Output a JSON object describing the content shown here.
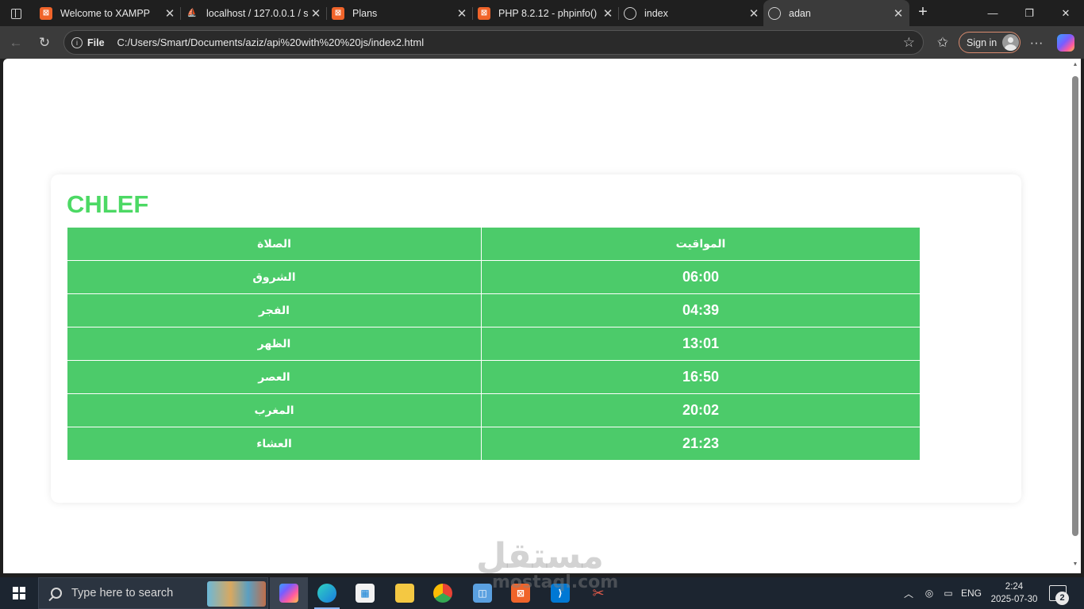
{
  "browser": {
    "tabs": [
      {
        "title": "Welcome to XAMPP",
        "favicon": "xampp-icon"
      },
      {
        "title": "localhost / 127.0.0.1 / s",
        "favicon": "phpmyadmin-icon"
      },
      {
        "title": "Plans",
        "favicon": "xampp-icon"
      },
      {
        "title": "PHP 8.2.12 - phpinfo()",
        "favicon": "xampp-icon"
      },
      {
        "title": "index",
        "favicon": "globe-icon"
      },
      {
        "title": "adan",
        "favicon": "globe-icon",
        "active": true
      }
    ],
    "address_bar": {
      "protocol_label": "File",
      "url": "C:/Users/Smart/Documents/aziz/api%20with%20%20js/index2.html"
    },
    "sign_in_label": "Sign in"
  },
  "page": {
    "city": "CHLEF",
    "table": {
      "headers": [
        "الصلاة",
        "المواقيت"
      ],
      "rows": [
        {
          "prayer": "الشروق",
          "time": "06:00"
        },
        {
          "prayer": "الفجر",
          "time": "04:39"
        },
        {
          "prayer": "الظهر",
          "time": "13:01"
        },
        {
          "prayer": "العصر",
          "time": "16:50"
        },
        {
          "prayer": "المغرب",
          "time": "20:02"
        },
        {
          "prayer": "العشاء",
          "time": "21:23"
        }
      ]
    },
    "accent_color": "#4cd964",
    "table_color": "#4ccb6a"
  },
  "watermark": {
    "arabic": "مستقل",
    "latin": "mostaql.com"
  },
  "taskbar": {
    "search_placeholder": "Type here to search",
    "language": "ENG",
    "time": "2:24",
    "date": "2025-07-30",
    "notification_count": "2"
  }
}
